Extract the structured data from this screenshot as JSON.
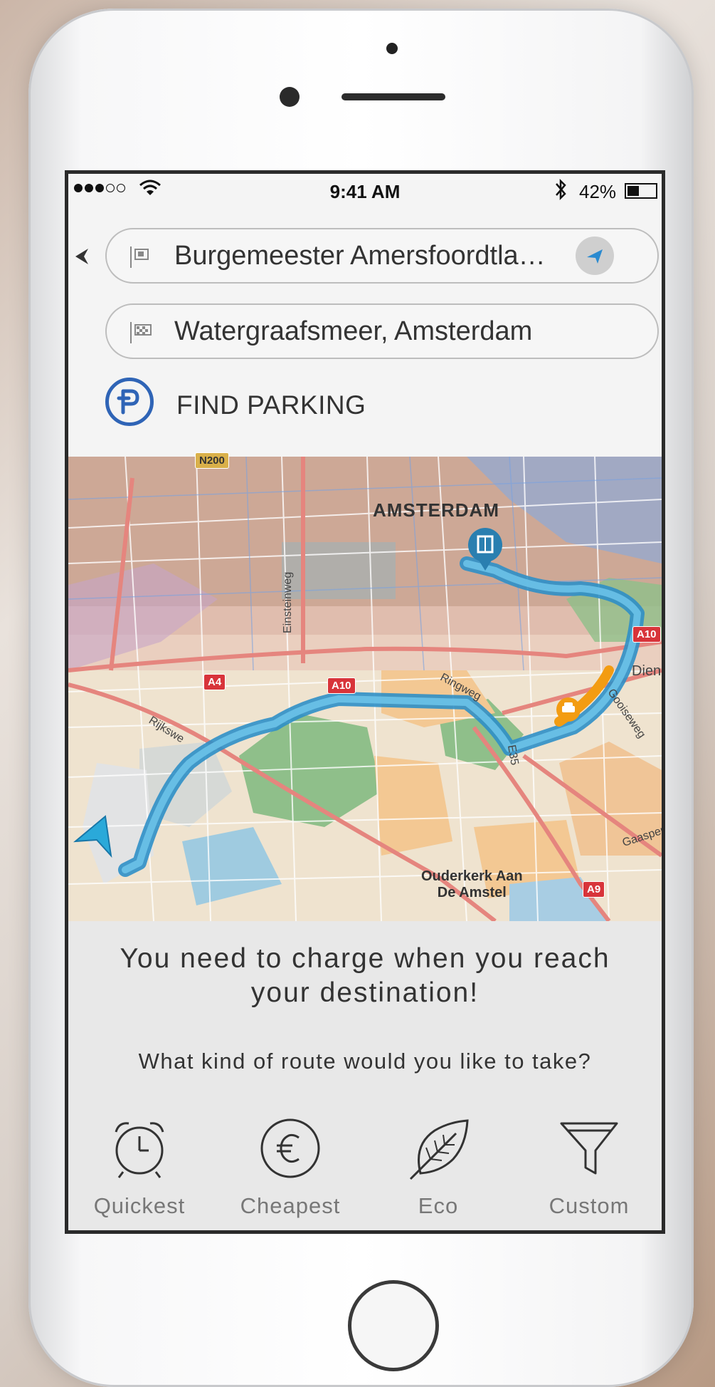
{
  "status_bar": {
    "time": "9:41 AM",
    "battery_percent": "42%",
    "battery_level": 0.42,
    "signal_bars": 3,
    "signal_total": 5
  },
  "search": {
    "from_value": "Burgemeester Amersfoordtla…",
    "to_value": "Watergraafsmeer, Amsterdam"
  },
  "parking": {
    "label": "FIND PARKING"
  },
  "map": {
    "city_label": "AMSTERDAM",
    "town_label_line1": "Ouderkerk Aan",
    "town_label_line2": "De Amstel",
    "road_shields": [
      "N200",
      "A10",
      "A10",
      "A4",
      "A9"
    ],
    "streets": [
      "Einsteinweg",
      "Rijkswe",
      "Ringweg",
      "Gooiseweg",
      "E35",
      "Dien",
      "Gaasper"
    ],
    "route_color": "#4aa7d6",
    "traffic_color": "#f39c12"
  },
  "message": {
    "line1": "You need to charge when you reach",
    "line2": "your destination!",
    "question": "What kind of route would you like to take?"
  },
  "route_options": [
    {
      "label": "Quickest",
      "icon": "alarm-clock-icon"
    },
    {
      "label": "Cheapest",
      "icon": "euro-coin-icon"
    },
    {
      "label": "Eco",
      "icon": "leaf-icon"
    },
    {
      "label": "Custom",
      "icon": "funnel-icon"
    }
  ],
  "colors": {
    "accent": "#2f64b6"
  }
}
